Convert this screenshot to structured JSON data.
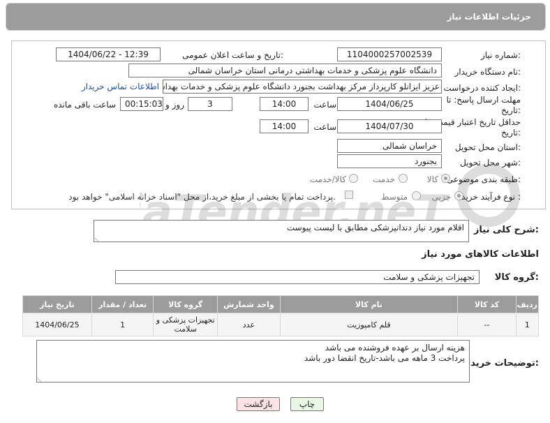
{
  "header": {
    "title": "جزئیات اطلاعات نیاز"
  },
  "form": {
    "need_number_label": "شماره نیاز:",
    "need_number": "1104000257002539",
    "announce_label": "تاریخ و ساعت اعلان عمومی:",
    "announce_value": "1404/06/22 - 12:39",
    "buyer_org_label": "نام دستگاه خریدار:",
    "buyer_org": "دانشگاه علوم پزشکی و خدمات بهداشتی درمانی استان خراسان شمالی",
    "creator_label": "ایجاد کننده درخواست:",
    "creator": "عزیز ایزانلو کارپرداز مرکز بهداشت بجنورد دانشگاه علوم پزشکی و خدمات بهداشت",
    "contact_link": "اطلاعات تماس خریدار",
    "reply_deadline_label": "مهلت ارسال پاسخ: تا تاریخ:",
    "reply_date": "1404/06/25",
    "time_label": "ساعت",
    "reply_time": "14:00",
    "days_value": "3",
    "days_label": "روز و",
    "remaining_time": "00:15:03",
    "remaining_label": "ساعت باقی مانده",
    "price_deadline_label": "حداقل تاریخ اعتبار قیمت: تا تاریخ:",
    "price_date": "1404/07/30",
    "price_time": "14:00",
    "province_label": "استان محل تحویل:",
    "province": "خراسان شمالی",
    "city_label": "شهر محل تحویل:",
    "city": "بجنورد",
    "category_label": "طبقه بندی موضوعی:",
    "category_options": [
      "کالا",
      "خدمت",
      "کالا/خدمت"
    ],
    "process_label": "نوع فرآیند خرید :",
    "process_options": [
      "جزیی",
      "متوسط"
    ],
    "payment_note": "پرداخت تمام یا بخشی از مبلغ خرید،از محل \"اسناد خزانه اسلامی\" خواهد بود."
  },
  "description": {
    "label": "شرح کلی نیاز:",
    "value": "اقلام مورد نیاز دندانپزشکی مطابق با لیست پیوست"
  },
  "goods_section": {
    "title": "اطلاعات کالاهای مورد نیاز",
    "group_label": "گروه کالا:",
    "group_value": "تجهیزات پزشکی و سلامت"
  },
  "table": {
    "headers": [
      "ردیف",
      "کد کالا",
      "نام کالا",
      "واحد شمارش",
      "گروه کالا",
      "تعداد / مقدار",
      "تاریخ نیاز"
    ],
    "rows": [
      [
        "1",
        "--",
        "قلم کامپوزیت",
        "عدد",
        "تجهیزات پزشکی و سلامت",
        "1",
        "1404/06/25"
      ]
    ]
  },
  "buyer_notes": {
    "label": "توضیحات خریدار:",
    "line1": "هزینه ارسال بر عهده فروشنده می باشد",
    "line2": "پرداخت 3 ماهه می باشد-تاریخ انقضا دور باشد"
  },
  "buttons": {
    "print": "چاپ",
    "back": "بازگشت"
  },
  "watermark": {
    "text": "AriaTender.neT"
  },
  "colors": {
    "header_bg": "#9c9c9c",
    "link": "#1a4fa0",
    "print_bg": "#e9f7e4",
    "back_bg": "#fbe3e6"
  }
}
